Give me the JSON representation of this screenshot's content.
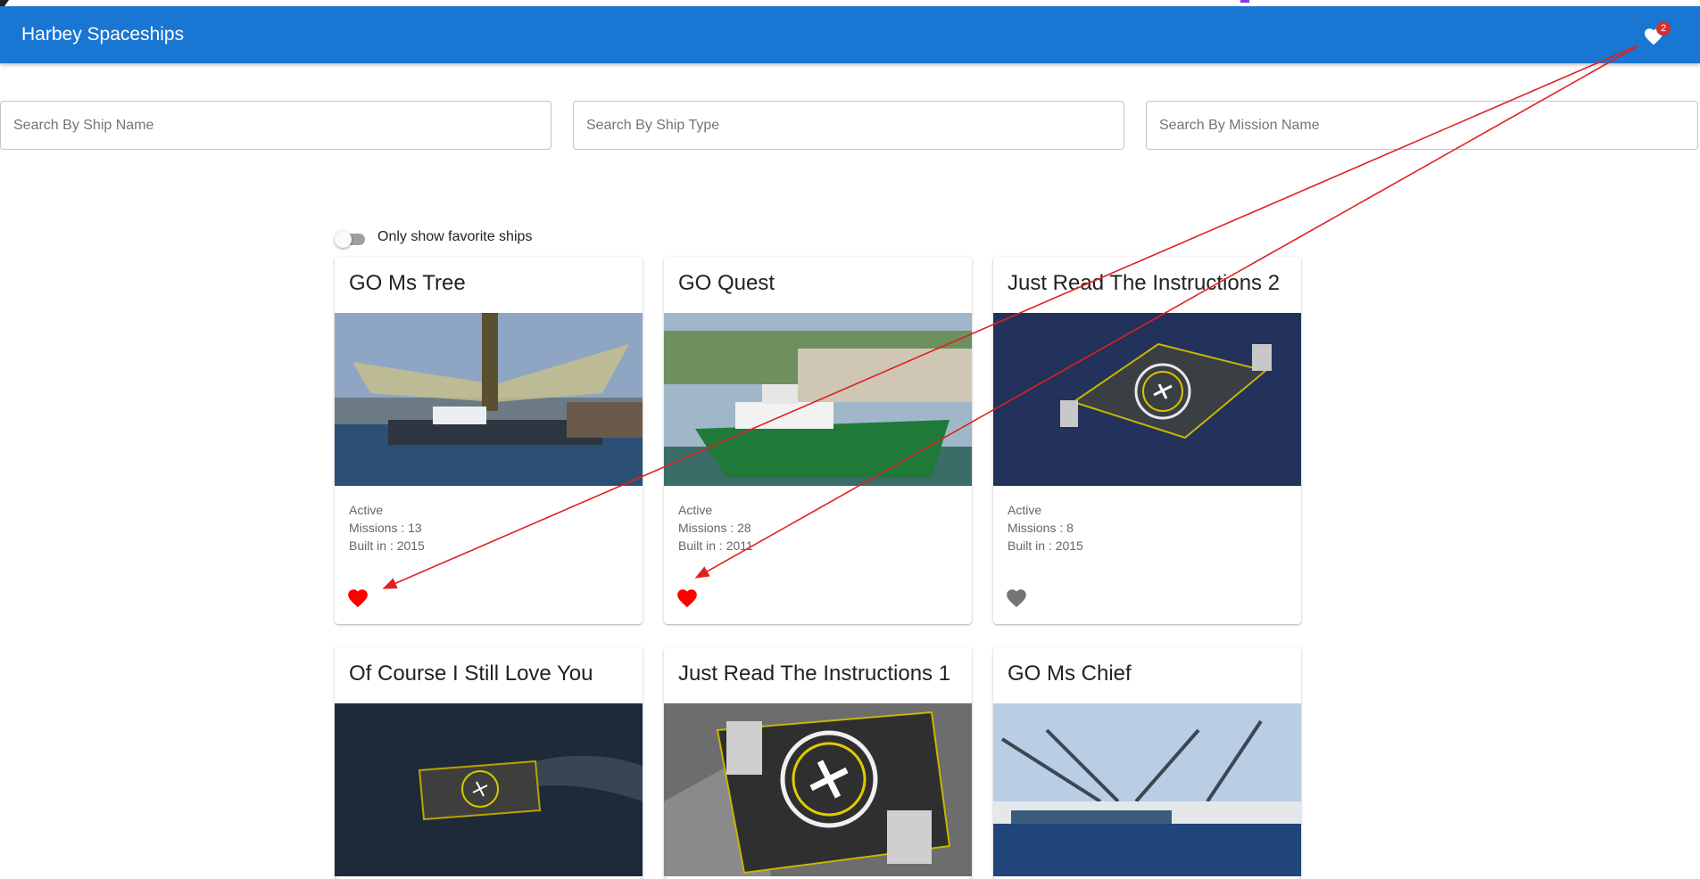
{
  "app": {
    "title": "Harbey Spaceships",
    "favorites_count": "2"
  },
  "search": {
    "ship_name_placeholder": "Search By Ship Name",
    "ship_type_placeholder": "Search By Ship Type",
    "mission_name_placeholder": "Search By Mission Name"
  },
  "filter": {
    "toggle_label": "Only show favorite ships",
    "toggle_on": false
  },
  "ships": [
    {
      "name": "GO Ms Tree",
      "status": "Active",
      "missions": "Missions : 13",
      "built": "Built in : 2015",
      "favorite": true
    },
    {
      "name": "GO Quest",
      "status": "Active",
      "missions": "Missions : 28",
      "built": "Built in : 2011",
      "favorite": true
    },
    {
      "name": "Just Read The Instructions 2",
      "status": "Active",
      "missions": "Missions : 8",
      "built": "Built in : 2015",
      "favorite": false
    },
    {
      "name": "Of Course I Still Love You",
      "favorite": false
    },
    {
      "name": "Just Read The Instructions 1",
      "favorite": false
    },
    {
      "name": "GO Ms Chief",
      "favorite": false
    }
  ],
  "colors": {
    "appbar": "#1976d2",
    "favorite_active": "#ff0000",
    "favorite_inactive": "#757575",
    "annotation_arrow": "#e02020"
  }
}
